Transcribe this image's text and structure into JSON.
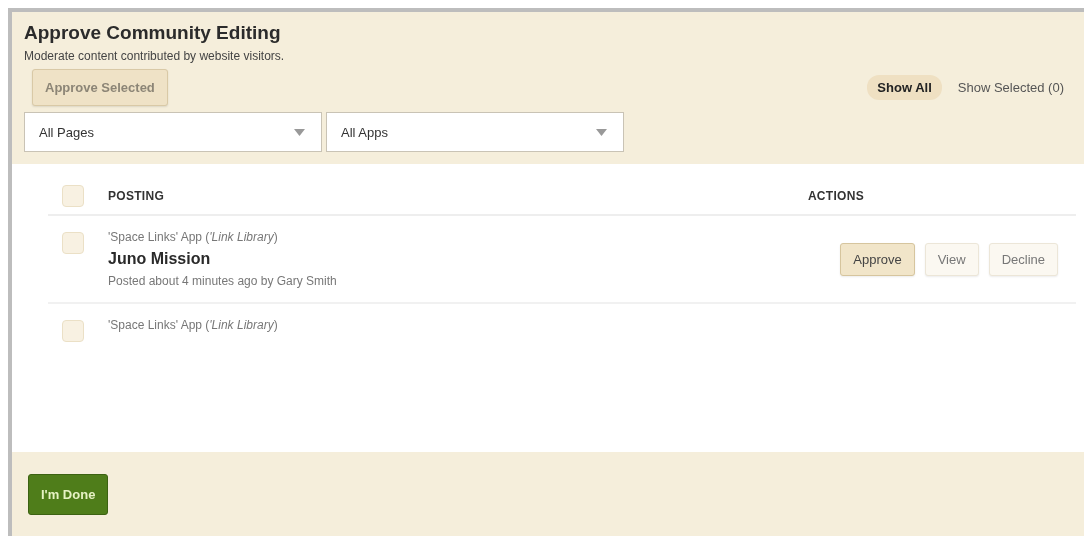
{
  "header": {
    "title": "Approve Community Editing",
    "subtitle": "Moderate content contributed by website visitors.",
    "approve_selected": "Approve Selected"
  },
  "view_tabs": [
    {
      "label": "Show All",
      "selected": true
    },
    {
      "label": "Show Selected (0)",
      "selected": false
    }
  ],
  "filters": [
    {
      "value": "All Pages"
    },
    {
      "value": "All Apps"
    }
  ],
  "table": {
    "select_all_checked": false,
    "columns": [
      "POSTING",
      "ACTIONS"
    ],
    "rows": [
      {
        "checked": false,
        "source": "'Space Links' App (",
        "source_app": "'Link Library",
        ")": ")",
        "title": "Juno Mission",
        "meta": "Posted about 4 minutes ago by Gary Smith",
        "actions": [
          {
            "label": "Approve",
            "kind": "primary"
          },
          {
            "label": "View",
            "kind": "plain"
          },
          {
            "label": "Decline",
            "kind": "plain"
          }
        ]
      },
      {
        "checked": false,
        "source": "'Space Links' App (",
        "source_app": "'Link Library",
        ")": ")"
      }
    ]
  },
  "footer": {
    "done": "I'm Done"
  }
}
